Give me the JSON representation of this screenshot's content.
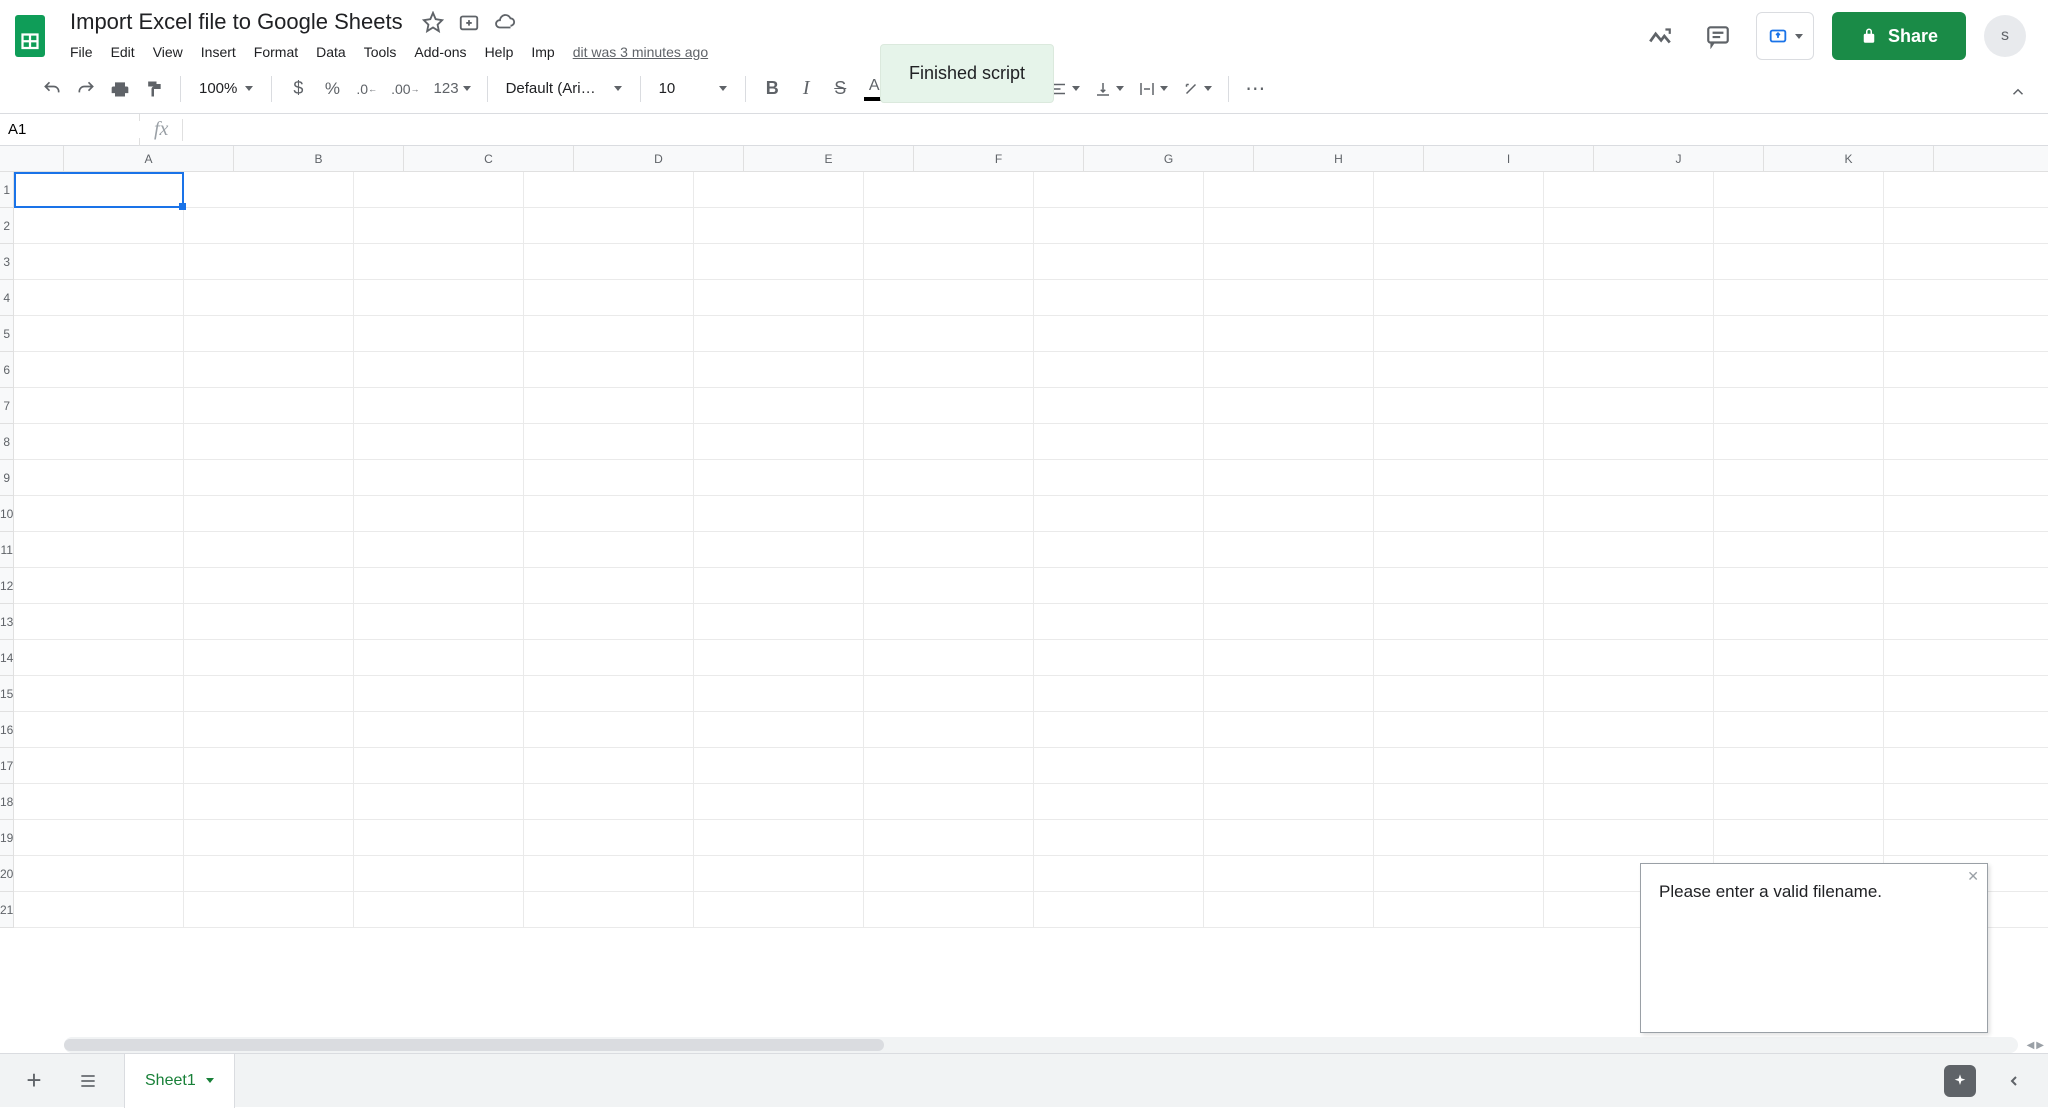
{
  "header": {
    "doc_title": "Import Excel file to Google Sheets",
    "last_edit": "dit was 3 minutes ago",
    "share_label": "Share",
    "avatar_initial": "s",
    "toast_text": "Finished script"
  },
  "menubar": {
    "items": [
      "File",
      "Edit",
      "View",
      "Insert",
      "Format",
      "Data",
      "Tools",
      "Add-ons",
      "Help",
      "Imp"
    ]
  },
  "toolbar": {
    "zoom": "100%",
    "font_name": "Default (Ari…",
    "font_size": "10",
    "more_formats": "123"
  },
  "formula": {
    "name_box": "A1",
    "formula_value": ""
  },
  "grid": {
    "columns": [
      "A",
      "B",
      "C",
      "D",
      "E",
      "F",
      "G",
      "H",
      "I",
      "J",
      "K"
    ],
    "row_count": 21,
    "selected_cell": "A1"
  },
  "popup": {
    "message": "Please enter a valid filename."
  },
  "sheetbar": {
    "tab_name": "Sheet1"
  }
}
